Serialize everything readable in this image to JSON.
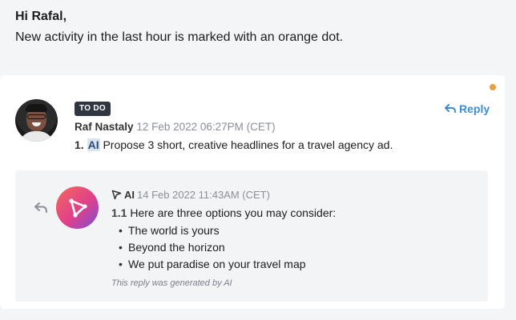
{
  "header": {
    "greeting": "Hi Rafal,",
    "subtitle": "New activity in the last hour is marked with an orange dot."
  },
  "colors": {
    "new_dot": "#e8a13c",
    "reply_link": "#3e8ed0",
    "badge_bg": "#2f3640"
  },
  "comment": {
    "badge": "TO DO",
    "reply_label": "Reply",
    "author": "Raf Nastaly",
    "timestamp": "12 Feb 2022 06:27PM (CET)",
    "number": "1.",
    "tag": "AI",
    "text": " Propose 3 short, creative headlines for a travel agency ad."
  },
  "ai_reply": {
    "author": "AI",
    "timestamp": "14 Feb 2022 11:43AM (CET)",
    "number": "1.1",
    "intro": " Here are three options you may consider:",
    "options": [
      "The world is yours",
      "Beyond the horizon",
      "We put paradise on your travel map"
    ],
    "note": "This reply was generated by AI"
  }
}
